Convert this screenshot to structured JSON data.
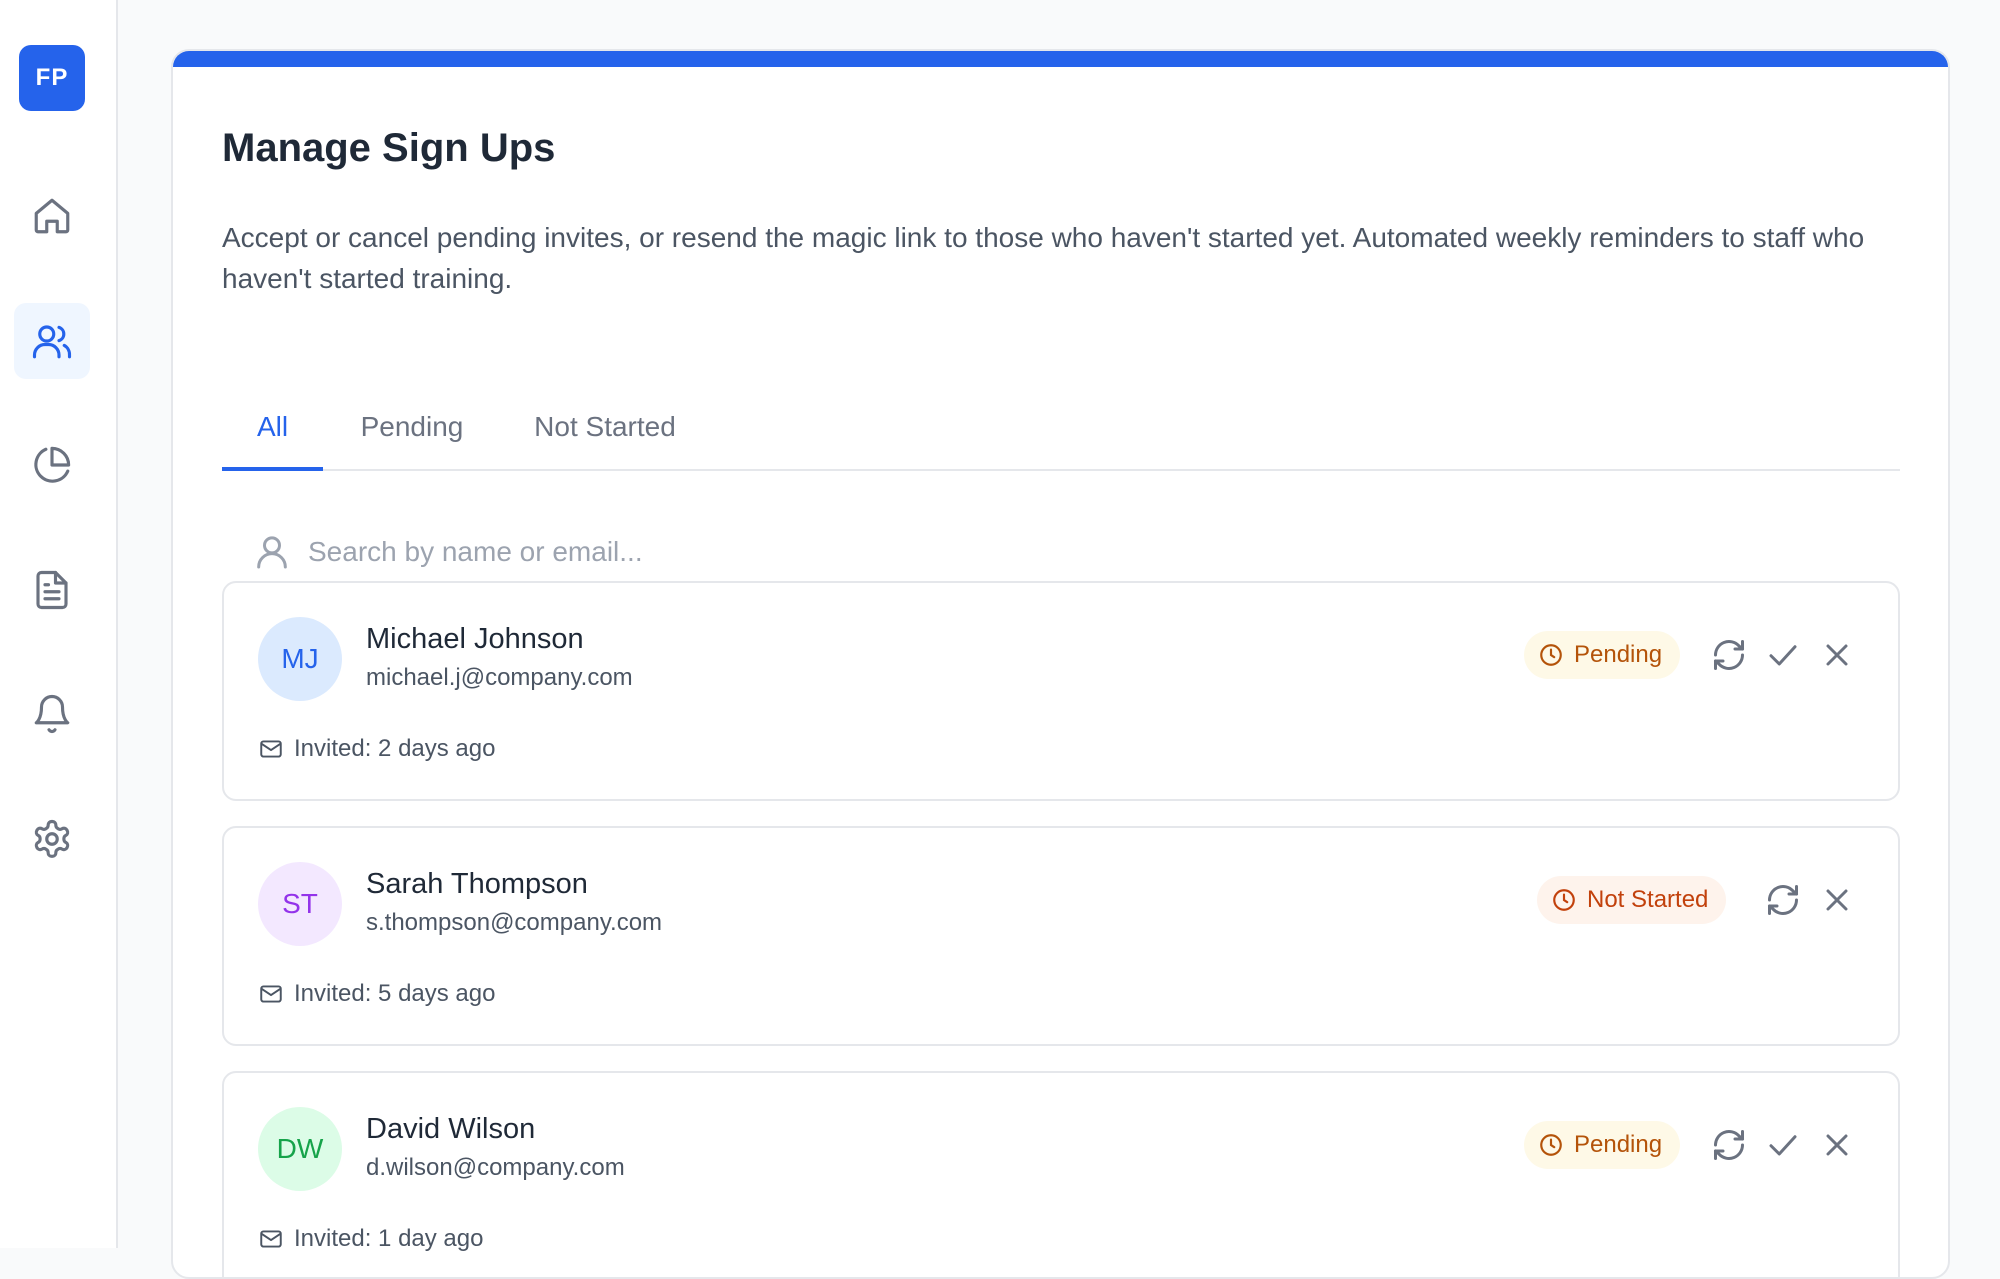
{
  "app": {
    "logo_text": "FP"
  },
  "sidebar": {
    "items": [
      {
        "name": "home",
        "icon": "home-icon",
        "active": false
      },
      {
        "name": "users",
        "icon": "users-icon",
        "active": true
      },
      {
        "name": "analytics",
        "icon": "pie-chart-icon",
        "active": false
      },
      {
        "name": "documents",
        "icon": "document-icon",
        "active": false
      },
      {
        "name": "notifications",
        "icon": "bell-icon",
        "active": false
      },
      {
        "name": "settings",
        "icon": "gear-icon",
        "active": false
      }
    ]
  },
  "header": {
    "title": "Manage Sign Ups",
    "description": "Accept or cancel pending invites, or resend the magic link to those who haven't started yet. Automated weekly reminders to staff who haven't started training."
  },
  "tabs": [
    {
      "label": "All",
      "active": true
    },
    {
      "label": "Pending",
      "active": false
    },
    {
      "label": "Not Started",
      "active": false
    }
  ],
  "search": {
    "placeholder": "Search by name or email...",
    "value": ""
  },
  "signups": [
    {
      "initials": "MJ",
      "name": "Michael Johnson",
      "email": "michael.j@company.com",
      "invited": "Invited: 2 days ago",
      "status": "Pending",
      "avatar_bg": "#dbeafe",
      "avatar_fg": "#2563eb"
    },
    {
      "initials": "ST",
      "name": "Sarah Thompson",
      "email": "s.thompson@company.com",
      "invited": "Invited: 5 days ago",
      "status": "Not Started",
      "avatar_bg": "#f3e8ff",
      "avatar_fg": "#9333ea"
    },
    {
      "initials": "DW",
      "name": "David Wilson",
      "email": "d.wilson@company.com",
      "invited": "Invited: 1 day ago",
      "status": "Pending",
      "avatar_bg": "#dcfce7",
      "avatar_fg": "#16a34a"
    }
  ],
  "colors": {
    "accent": "#2563eb",
    "pending": "#b45309",
    "not_started": "#c2410c"
  }
}
